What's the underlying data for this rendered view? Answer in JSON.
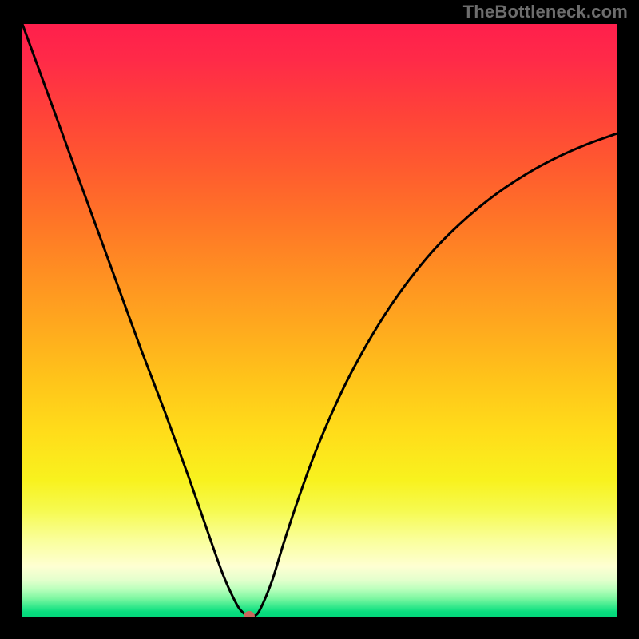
{
  "watermark": {
    "text": "TheBottleneck.com"
  },
  "chart_data": {
    "type": "line",
    "title": "",
    "xlabel": "",
    "ylabel": "",
    "xlim": [
      0,
      100
    ],
    "ylim": [
      0,
      100
    ],
    "grid": false,
    "legend": false,
    "gradient_colors": {
      "top": "#ff1f4c",
      "mid_high": "#ffa91e",
      "mid_low": "#ffdd1a",
      "low": "#faff9a",
      "bottom": "#04d87b"
    },
    "series": [
      {
        "name": "bottleneck-curve",
        "color": "#000000",
        "x": [
          0,
          4,
          8,
          12,
          16,
          20,
          24,
          28,
          32,
          34,
          36,
          37,
          38,
          39,
          40,
          42,
          44,
          47,
          50,
          54,
          58,
          62,
          66,
          70,
          75,
          80,
          85,
          90,
          95,
          100
        ],
        "y": [
          100,
          89,
          78,
          67,
          56,
          45,
          34.5,
          23.5,
          12,
          6.5,
          2.2,
          0.8,
          0.1,
          0.1,
          1.2,
          6.0,
          12.5,
          21.5,
          29.5,
          38.5,
          46.0,
          52.5,
          58.0,
          62.7,
          67.5,
          71.5,
          74.8,
          77.5,
          79.7,
          81.5
        ]
      }
    ],
    "marker": {
      "x": 38.2,
      "y": 0,
      "color": "#c9695e"
    }
  }
}
